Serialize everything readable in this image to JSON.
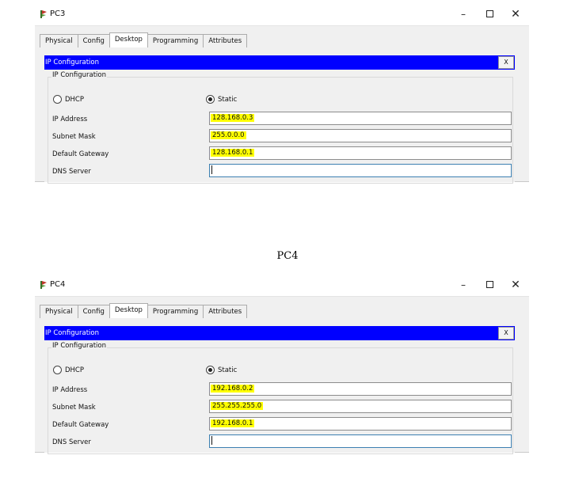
{
  "windows": [
    {
      "title": "PC3",
      "tabs": [
        "Physical",
        "Config",
        "Desktop",
        "Programming",
        "Attributes"
      ],
      "active_tab": "Desktop",
      "panel_title": "IP Configuration",
      "panel_close": "X",
      "group_label": "IP Configuration",
      "dhcp_label": "DHCP",
      "static_label": "Static",
      "mode": "Static",
      "labels": {
        "ip": "IP Address",
        "mask": "Subnet Mask",
        "gateway": "Default Gateway",
        "dns": "DNS Server"
      },
      "values": {
        "ip": "128.168.0.3",
        "mask": "255.0.0.0",
        "gateway": "128.168.0.1",
        "dns": ""
      },
      "highlight_color": "#ffff00"
    },
    {
      "title": "PC4",
      "tabs": [
        "Physical",
        "Config",
        "Desktop",
        "Programming",
        "Attributes"
      ],
      "active_tab": "Desktop",
      "panel_title": "IP Configuration",
      "panel_close": "X",
      "group_label": "IP Configuration",
      "dhcp_label": "DHCP",
      "static_label": "Static",
      "mode": "Static",
      "labels": {
        "ip": "IP Address",
        "mask": "Subnet Mask",
        "gateway": "Default Gateway",
        "dns": "DNS Server"
      },
      "values": {
        "ip": "192.168.0.2",
        "mask": "255.255.255.0",
        "gateway": "192.168.0.1",
        "dns": ""
      },
      "highlight_color": "#ffff00"
    }
  ],
  "caption": "PC4",
  "window_controls": {
    "minimize": "–",
    "close": "✕"
  },
  "colors": {
    "panel_bar": "#0000ff",
    "highlight": "#ffff00",
    "focus_border": "#3c7fb1"
  }
}
